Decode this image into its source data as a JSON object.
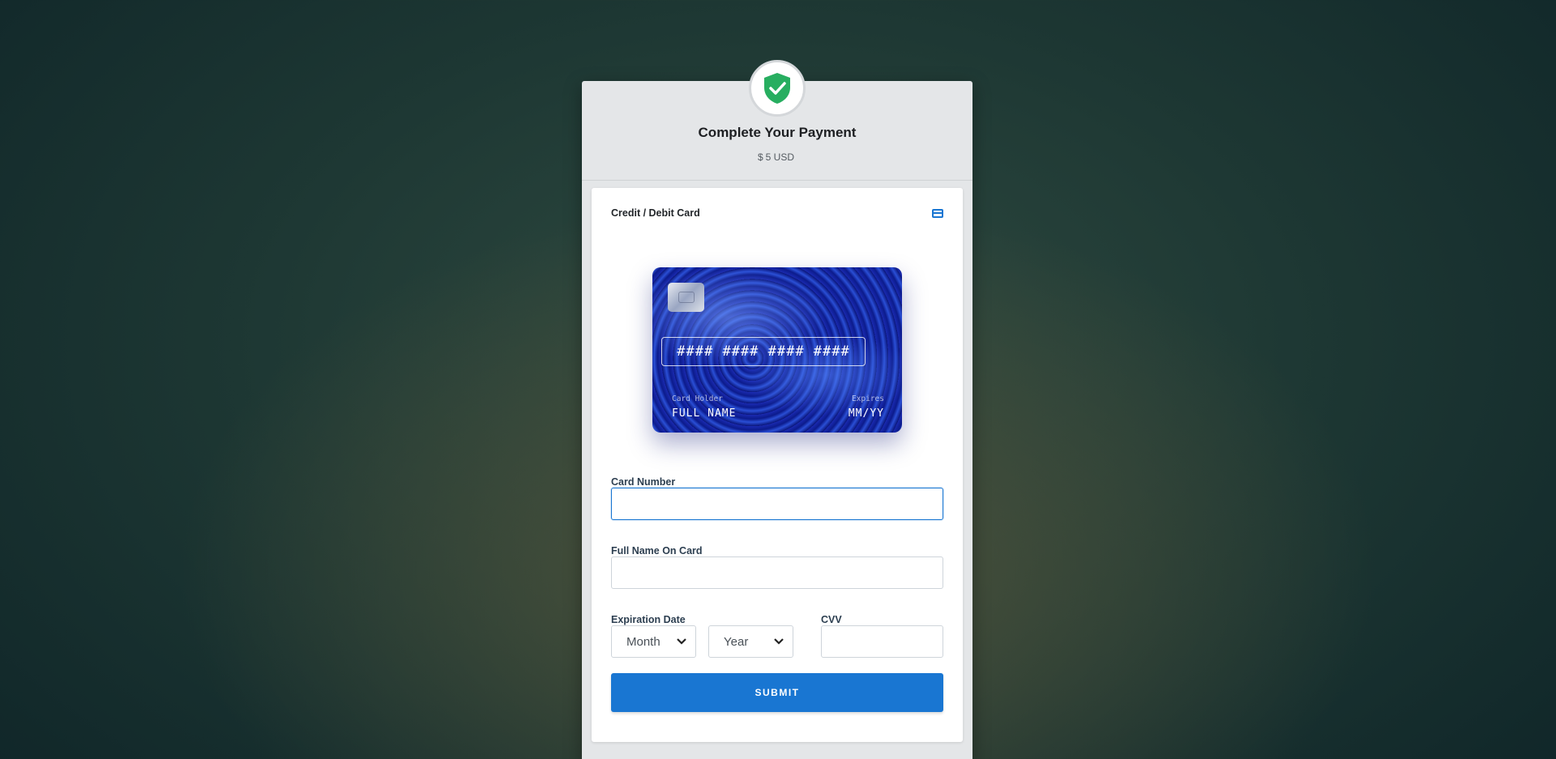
{
  "header": {
    "title": "Complete Your Payment",
    "amount_symbol": "$",
    "amount_value": "5 USD"
  },
  "method": {
    "label": "Credit / Debit Card",
    "icon": "credit-card-icon"
  },
  "card_preview": {
    "number": "#### #### #### ####",
    "holder_label": "Card Holder",
    "holder_value": "FULL NAME",
    "expires_label": "Expires",
    "expires_value": "MM/YY"
  },
  "form": {
    "card_number_label": "Card Number",
    "card_number_value": "",
    "full_name_label": "Full Name On Card",
    "full_name_value": "",
    "expiration_label": "Expiration Date",
    "month_selected": "Month",
    "year_selected": "Year",
    "cvv_label": "CVV",
    "cvv_value": "",
    "submit_label": "SUBMIT"
  },
  "colors": {
    "accent": "#1976d2",
    "shield": "#27ae60"
  }
}
